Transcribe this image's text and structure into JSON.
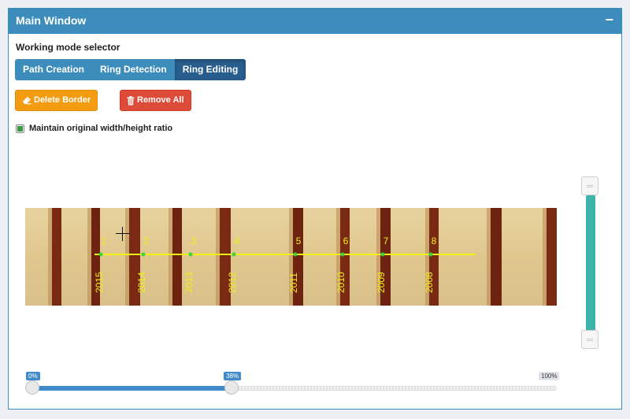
{
  "window": {
    "title": "Main Window",
    "minimize_glyph": "−"
  },
  "mode": {
    "label": "Working mode selector",
    "tabs": [
      {
        "label": "Path Creation",
        "active": false
      },
      {
        "label": "Ring Detection",
        "active": false
      },
      {
        "label": "Ring Editing",
        "active": true
      }
    ]
  },
  "buttons": {
    "delete_border": {
      "label": "Delete Border",
      "icon": "eraser-icon",
      "color": "#f39c12"
    },
    "remove_all": {
      "label": "Remove All",
      "icon": "trash-icon",
      "color": "#dd4b39"
    }
  },
  "aspect": {
    "label": "Maintain original width/height ratio",
    "checked": true
  },
  "rings": {
    "numbers": [
      "1",
      "2",
      "3",
      "4",
      "5",
      "6",
      "7",
      "8"
    ],
    "years": [
      "2015",
      "2014",
      "2013",
      "2012",
      "2011",
      "2010",
      "2009",
      "2008"
    ],
    "path_color": "#f0f015",
    "point_color": "#3cd23c"
  },
  "zoom_slider": {
    "min_label": "0%",
    "value_label": "38%",
    "max_label": "100%",
    "value": 0.38
  },
  "vertical_slider": {
    "color": "#3cb4a8"
  }
}
